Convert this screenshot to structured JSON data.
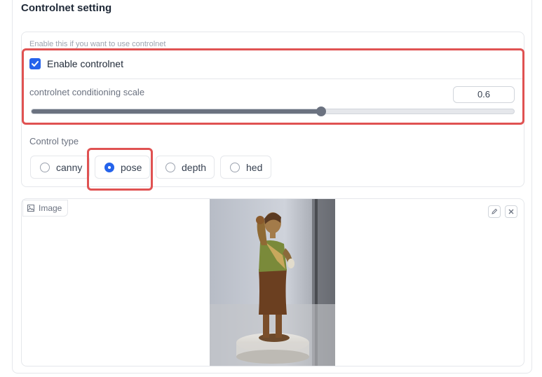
{
  "section": {
    "title": "Controlnet setting"
  },
  "controlnet": {
    "hint": "Enable this if you want to use controlnet",
    "enable_label": "Enable controlnet",
    "enabled": true,
    "scale_label": "controlnet conditioning scale",
    "scale_value": "0.6",
    "scale_min": 0,
    "scale_max": 1
  },
  "control_type": {
    "label": "Control type",
    "options": [
      "canny",
      "pose",
      "depth",
      "hed"
    ],
    "selected": "pose"
  },
  "image": {
    "label": "Image",
    "icons": [
      "image-icon",
      "edit-icon",
      "close-icon"
    ]
  },
  "colors": {
    "accent": "#2563eb",
    "highlight": "#e05252",
    "slider": "#6b7280"
  }
}
